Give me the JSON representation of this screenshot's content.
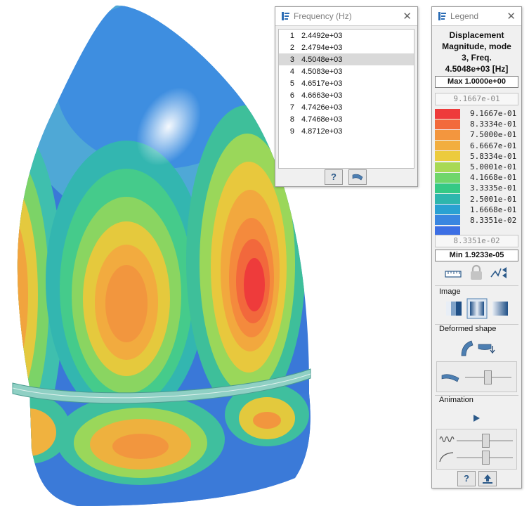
{
  "frequency_panel": {
    "title": "Frequency (Hz)",
    "rows": [
      {
        "index": "1",
        "value": "2.4492e+03"
      },
      {
        "index": "2",
        "value": "2.4794e+03"
      },
      {
        "index": "3",
        "value": "4.5048e+03"
      },
      {
        "index": "4",
        "value": "4.5083e+03"
      },
      {
        "index": "5",
        "value": "4.6517e+03"
      },
      {
        "index": "6",
        "value": "4.6663e+03"
      },
      {
        "index": "7",
        "value": "4.7426e+03"
      },
      {
        "index": "8",
        "value": "4.7468e+03"
      },
      {
        "index": "9",
        "value": "4.8712e+03"
      }
    ],
    "selected_index": 2,
    "help_label": "?"
  },
  "legend_panel": {
    "title": "Legend",
    "heading_lines": [
      "Displacement",
      "Magnitude, mode",
      "3, Freq.",
      "4.5048e+03 [Hz]"
    ],
    "max_label": "Max",
    "max_value": "1.0000e+00",
    "upper_field": "9.1667e-01",
    "swatches": [
      {
        "color": "#ee3b3b",
        "label": "9.1667e-01"
      },
      {
        "color": "#f26a3c",
        "label": "8.3334e-01"
      },
      {
        "color": "#f3963e",
        "label": "7.5000e-01"
      },
      {
        "color": "#f2ae3f",
        "label": "6.6667e-01"
      },
      {
        "color": "#eccb3d",
        "label": "5.8334e-01"
      },
      {
        "color": "#a8d955",
        "label": "5.0001e-01"
      },
      {
        "color": "#6fd66b",
        "label": "4.1668e-01"
      },
      {
        "color": "#35c985",
        "label": "3.3335e-01"
      },
      {
        "color": "#2eb6ad",
        "label": "2.5001e-01"
      },
      {
        "color": "#2aa1d2",
        "label": "1.6668e-01"
      },
      {
        "color": "#3a86e0",
        "label": "8.3351e-02"
      },
      {
        "color": "#3d6fe4",
        "label": ""
      }
    ],
    "lower_field": "8.3351e-02",
    "min_label": "Min",
    "min_value": "1.9233e-05",
    "image_section": "Image",
    "deformed_section": "Deformed shape",
    "animation_section": "Animation",
    "help_label": "?"
  }
}
